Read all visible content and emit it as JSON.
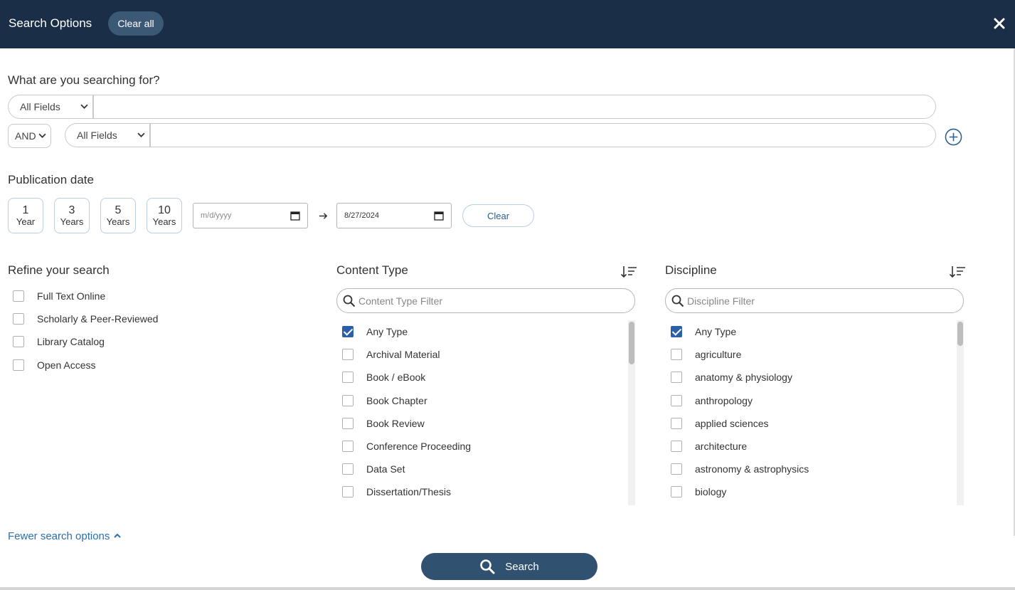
{
  "header": {
    "title": "Search Options",
    "clear_all_label": "Clear all",
    "close_icon": "close-icon"
  },
  "query": {
    "heading": "What are you searching for?",
    "rows": [
      {
        "field": "All Fields",
        "value": ""
      },
      {
        "operator": "AND",
        "field": "All Fields",
        "value": ""
      }
    ],
    "add_row_icon": "plus-circle-icon"
  },
  "publication_date": {
    "heading": "Publication date",
    "ranges": [
      {
        "num": "1",
        "unit": "Year"
      },
      {
        "num": "3",
        "unit": "Years"
      },
      {
        "num": "5",
        "unit": "Years"
      },
      {
        "num": "10",
        "unit": "Years"
      }
    ],
    "from_placeholder": "m/d/yyyy",
    "to_value": "8/27/2024",
    "clear_label": "Clear"
  },
  "refine": {
    "heading": "Refine your search",
    "items": [
      {
        "label": "Full Text Online",
        "checked": false
      },
      {
        "label": "Scholarly & Peer-Reviewed",
        "checked": false
      },
      {
        "label": "Library Catalog",
        "checked": false
      },
      {
        "label": "Open Access",
        "checked": false
      }
    ]
  },
  "content_type": {
    "heading": "Content Type",
    "filter_placeholder": "Content Type Filter",
    "items": [
      {
        "label": "Any Type",
        "checked": true
      },
      {
        "label": "Archival Material",
        "checked": false
      },
      {
        "label": "Book / eBook",
        "checked": false
      },
      {
        "label": "Book Chapter",
        "checked": false
      },
      {
        "label": "Book Review",
        "checked": false
      },
      {
        "label": "Conference Proceeding",
        "checked": false
      },
      {
        "label": "Data Set",
        "checked": false
      },
      {
        "label": "Dissertation/Thesis",
        "checked": false
      }
    ]
  },
  "discipline": {
    "heading": "Discipline",
    "filter_placeholder": "Discipline Filter",
    "items": [
      {
        "label": "Any Type",
        "checked": true
      },
      {
        "label": "agriculture",
        "checked": false
      },
      {
        "label": "anatomy & physiology",
        "checked": false
      },
      {
        "label": "anthropology",
        "checked": false
      },
      {
        "label": "applied sciences",
        "checked": false
      },
      {
        "label": "architecture",
        "checked": false
      },
      {
        "label": "astronomy & astrophysics",
        "checked": false
      },
      {
        "label": "biology",
        "checked": false
      }
    ]
  },
  "footer": {
    "fewer_label": "Fewer search options",
    "search_label": "Search"
  },
  "colors": {
    "header_bg": "#1a2f47",
    "accent": "#2b5fa8",
    "search_button": "#30516f",
    "link": "#2a6fb0"
  }
}
